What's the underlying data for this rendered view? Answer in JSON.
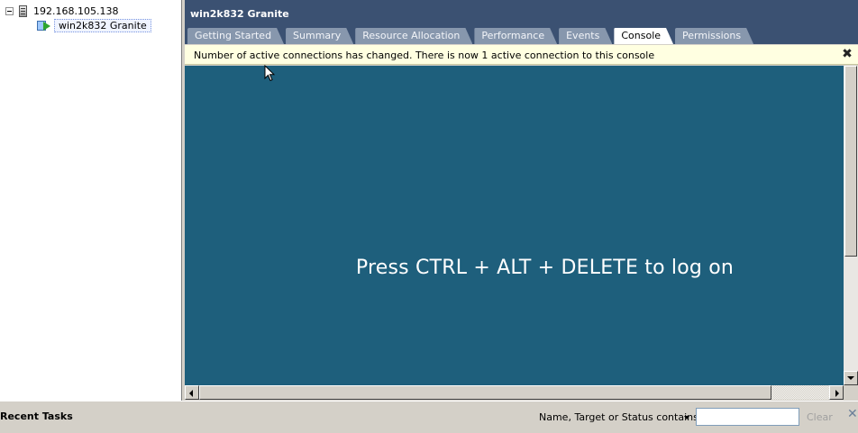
{
  "tree": {
    "host": "192.168.105.138",
    "vm": "win2k832 Granite"
  },
  "header": {
    "title": "win2k832 Granite",
    "tabs": [
      {
        "label": "Getting Started",
        "active": false
      },
      {
        "label": "Summary",
        "active": false
      },
      {
        "label": "Resource Allocation",
        "active": false
      },
      {
        "label": "Performance",
        "active": false
      },
      {
        "label": "Events",
        "active": false
      },
      {
        "label": "Console",
        "active": true
      },
      {
        "label": "Permissions",
        "active": false
      }
    ]
  },
  "notice": {
    "text": "Number of active connections has changed. There is now 1 active connection to this console",
    "close_icon": "close-icon"
  },
  "console": {
    "message": "Press CTRL + ALT + DELETE to log on",
    "background": "#1e5f7c"
  },
  "tasks": {
    "title": "Recent Tasks",
    "filter_label": "Name, Target or Status contains:",
    "filter_value": "",
    "clear_label": "Clear",
    "close_glyph": "✕"
  },
  "colors": {
    "header_bg": "#3b5172",
    "notice_bg": "#ffffe1",
    "tab_inactive": "#8797ad"
  }
}
